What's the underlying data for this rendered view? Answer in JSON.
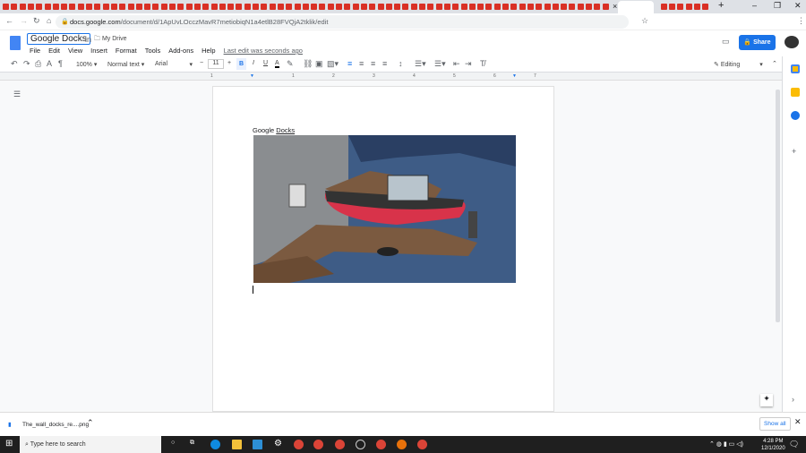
{
  "browser": {
    "url_host": "docs.google.com",
    "url_path": "/document/d/1ApUvLOcczMavR7metiobiqN1a4etlB28FVQjA2tklik/edit",
    "new_tab": "+",
    "close_tab": "×"
  },
  "docs": {
    "doc_title": "Google Docks",
    "in_label": "in",
    "folder": "My Drive",
    "menu": [
      "File",
      "Edit",
      "View",
      "Insert",
      "Format",
      "Tools",
      "Add-ons",
      "Help"
    ],
    "last_edit": "Last edit was seconds ago",
    "share_label": "Share"
  },
  "toolbar": {
    "zoom": "100%",
    "style": "Normal text",
    "font": "Arial",
    "font_size": "11",
    "mode": "Editing"
  },
  "ruler": [
    "1",
    "1",
    "2",
    "3",
    "4",
    "5",
    "6",
    "7"
  ],
  "document": {
    "text_plain": "Google ",
    "text_underlined": "Docks"
  },
  "download": {
    "file": "The_wall_docks_re....png",
    "show_all": "Show all"
  },
  "taskbar": {
    "search_placeholder": "Type here to search",
    "time": "4:28 PM",
    "date": "12/1/2020"
  },
  "colors": {
    "accent": "#1a73e8",
    "taskbar": "#1f1f1f"
  }
}
